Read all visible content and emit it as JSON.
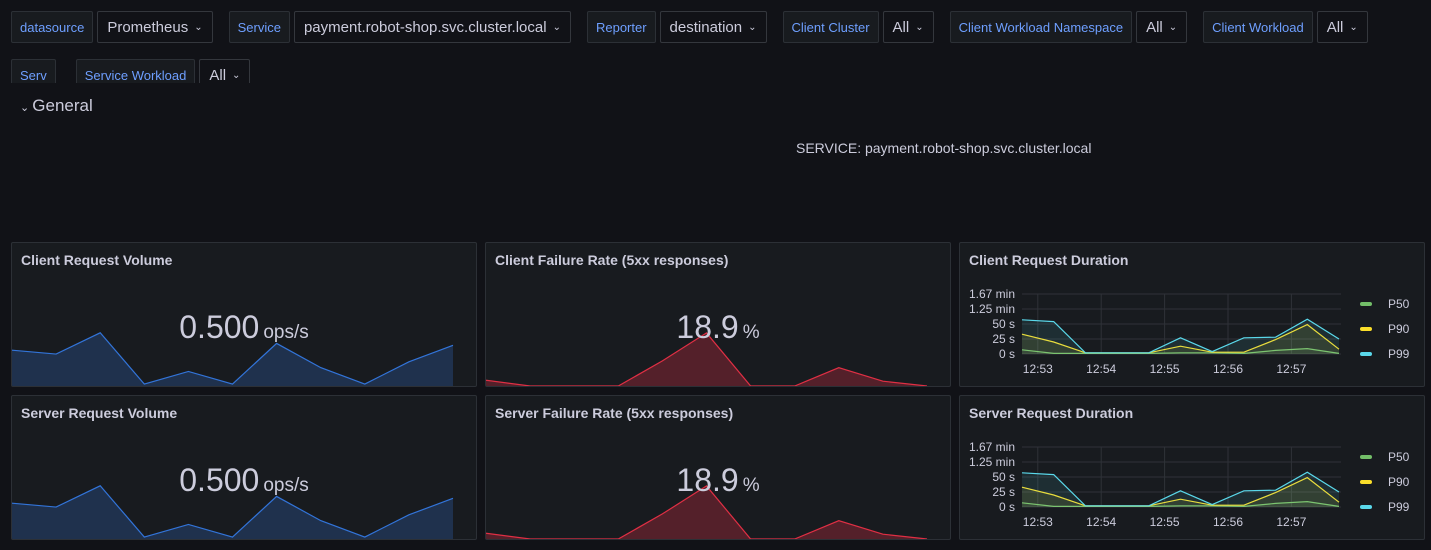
{
  "variables": [
    {
      "label": "datasource",
      "value": "Prometheus"
    },
    {
      "label": "Service",
      "value": "payment.robot-shop.svc.cluster.local"
    },
    {
      "label": "Reporter",
      "value": "destination"
    },
    {
      "label": "Client Cluster",
      "value": "All"
    },
    {
      "label": "Client Workload Namespace",
      "value": "All"
    },
    {
      "label": "Client Workload",
      "value": "All"
    },
    {
      "label": "Serv",
      "value": ""
    },
    {
      "label": "Service Workload",
      "value": "All"
    }
  ],
  "row": {
    "title": "General"
  },
  "text_panel": "SERVICE: payment.robot-shop.svc.cluster.local",
  "colors": {
    "ops": "#3274d9",
    "fail": "#e02f44",
    "p50": "#73bf69",
    "p90": "#fade2a",
    "p99": "#5ad8ea"
  },
  "panels": {
    "client_volume": {
      "title": "Client Request Volume",
      "value": "0.500",
      "unit": "ops/s"
    },
    "client_failure": {
      "title": "Client Failure Rate (5xx responses)",
      "value": "18.9",
      "unit": "%"
    },
    "client_duration": {
      "title": "Client Request Duration"
    },
    "server_volume": {
      "title": "Server Request Volume",
      "value": "0.500",
      "unit": "ops/s"
    },
    "server_failure": {
      "title": "Server Failure Rate (5xx responses)",
      "value": "18.9",
      "unit": "%"
    },
    "server_duration": {
      "title": "Server Request Duration"
    }
  },
  "chart_data": [
    {
      "type": "area",
      "name": "volume-sparkline",
      "values": [
        0.37,
        0.33,
        0.55,
        0.02,
        0.15,
        0.02,
        0.44,
        0.19,
        0.02,
        0.25,
        0.42
      ]
    },
    {
      "type": "area",
      "name": "failure-sparkline",
      "values": [
        6,
        0,
        0,
        0,
        26,
        55,
        0,
        0,
        19,
        5,
        0
      ]
    },
    {
      "type": "line",
      "x": [
        "12:52:45",
        "12:53:15",
        "12:53:45",
        "12:54:15",
        "12:54:45",
        "12:55:15",
        "12:55:45",
        "12:56:15",
        "12:56:45",
        "12:57:15",
        "12:57:45"
      ],
      "xticks": [
        "12:53",
        "12:54",
        "12:55",
        "12:56",
        "12:57"
      ],
      "yticks": [
        "0 s",
        "25 s",
        "50 s",
        "1.25 min",
        "1.67 min"
      ],
      "ylim_seconds": [
        0,
        100
      ],
      "grid": true,
      "legend": "right",
      "series": [
        {
          "name": "P50",
          "values": [
            7,
            1,
            1,
            1,
            1,
            2,
            2,
            1,
            6,
            9,
            1
          ]
        },
        {
          "name": "P90",
          "values": [
            33,
            20,
            2,
            2,
            2,
            13,
            3,
            3,
            24,
            49,
            8
          ]
        },
        {
          "name": "P99",
          "values": [
            57,
            54,
            2,
            2,
            2,
            27,
            4,
            27,
            28,
            58,
            25
          ]
        }
      ]
    }
  ]
}
